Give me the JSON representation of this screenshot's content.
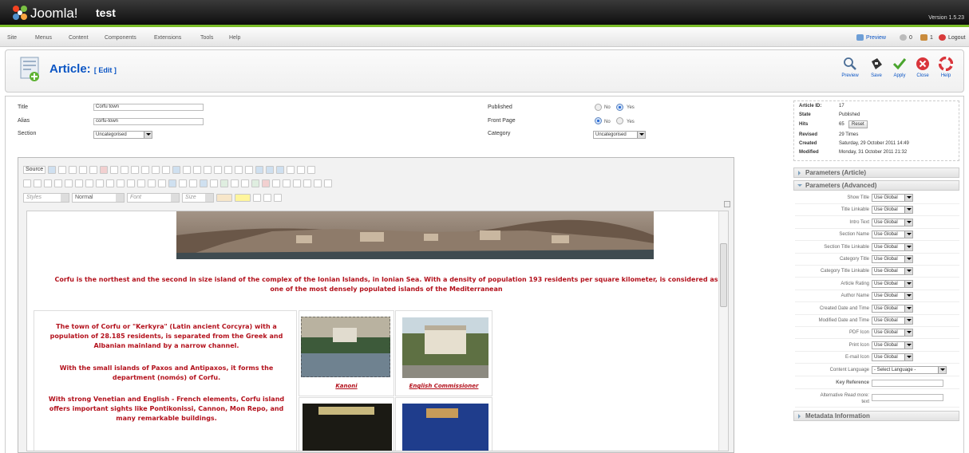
{
  "header": {
    "brand": "Joomla!",
    "site_name": "test",
    "version": "Version 1.5.23"
  },
  "menu": {
    "items": [
      "Site",
      "Menus",
      "Content",
      "Components",
      "Extensions",
      "Tools",
      "Help"
    ]
  },
  "status": {
    "preview": "Preview",
    "messages": "0",
    "users": "1",
    "logout": "Logout"
  },
  "toolbar": {
    "title": "Article:",
    "subtitle": "[ Edit ]",
    "buttons": [
      "Preview",
      "Save",
      "Apply",
      "Close",
      "Help"
    ]
  },
  "form": {
    "title_label": "Title",
    "title_value": "Corfu town",
    "alias_label": "Alias",
    "alias_value": "corfu-town",
    "section_label": "Section",
    "section_value": "Uncategorised",
    "published_label": "Published",
    "frontpage_label": "Front Page",
    "category_label": "Category",
    "category_value": "Uncategorised",
    "no": "No",
    "yes": "Yes"
  },
  "editor": {
    "source": "Source",
    "styles": "Styles",
    "format": "Normal",
    "font": "Font",
    "size": "Size",
    "intro": "Corfu is the northest and the second in size island of the complex of the Ionian Islands, in Ionian Sea. With a density of population 193 residents per square kilometer, is considered as one of the most densely populated islands of the Mediterranean",
    "para1": "The town of Corfu or \"Kerkyra\" (Latin ancient Corcyra) with a population of 28.185 residents, is separated from the Greek and Albanian mainland by a narrow channel.",
    "para2": "With the small islands of Paxos and Antipaxos, it forms the department (nomós) of Corfu.",
    "para3": "With strong Venetian and English - French elements, Corfu island offers important sights like Pontikonissi, Cannon, Mon Repo, and many remarkable buildings.",
    "caption1": "Kanoni",
    "caption2": "English Commissioner"
  },
  "details": {
    "article_id_label": "Article ID:",
    "article_id": "17",
    "state_label": "State",
    "state": "Published",
    "hits_label": "Hits",
    "hits": "65",
    "reset": "Reset",
    "revised_label": "Revised",
    "revised": "29 Times",
    "created_label": "Created",
    "created": "Saturday, 29 October 2011 14:49",
    "modified_label": "Modified",
    "modified": "Monday, 31 October 2011 21:32"
  },
  "panes": {
    "article": "Parameters (Article)",
    "advanced": "Parameters (Advanced)",
    "metadata": "Metadata Information"
  },
  "params": [
    {
      "label": "Show Title",
      "value": "Use Global"
    },
    {
      "label": "Title Linkable",
      "value": "Use Global"
    },
    {
      "label": "Intro Text",
      "value": "Use Global"
    },
    {
      "label": "Section Name",
      "value": "Use Global"
    },
    {
      "label": "Section Title Linkable",
      "value": "Use Global"
    },
    {
      "label": "Category Title",
      "value": "Use Global"
    },
    {
      "label": "Category Title Linkable",
      "value": "Use Global"
    },
    {
      "label": "Article Rating",
      "value": "Use Global"
    },
    {
      "label": "Author Name",
      "value": "Use Global"
    },
    {
      "label": "Created Date and Time",
      "value": "Use Global"
    },
    {
      "label": "Modified Date and Time",
      "value": "Use Global"
    },
    {
      "label": "PDF Icon",
      "value": "Use Global"
    },
    {
      "label": "Print Icon",
      "value": "Use Global"
    },
    {
      "label": "E-mail Icon",
      "value": "Use Global"
    }
  ],
  "lang": {
    "label": "Content Language",
    "value": "- Select Language -",
    "key_ref": "Key Reference",
    "alt_read_a": "Alternative ",
    "alt_read_b": "Read more:",
    "alt_read_c": "text"
  }
}
